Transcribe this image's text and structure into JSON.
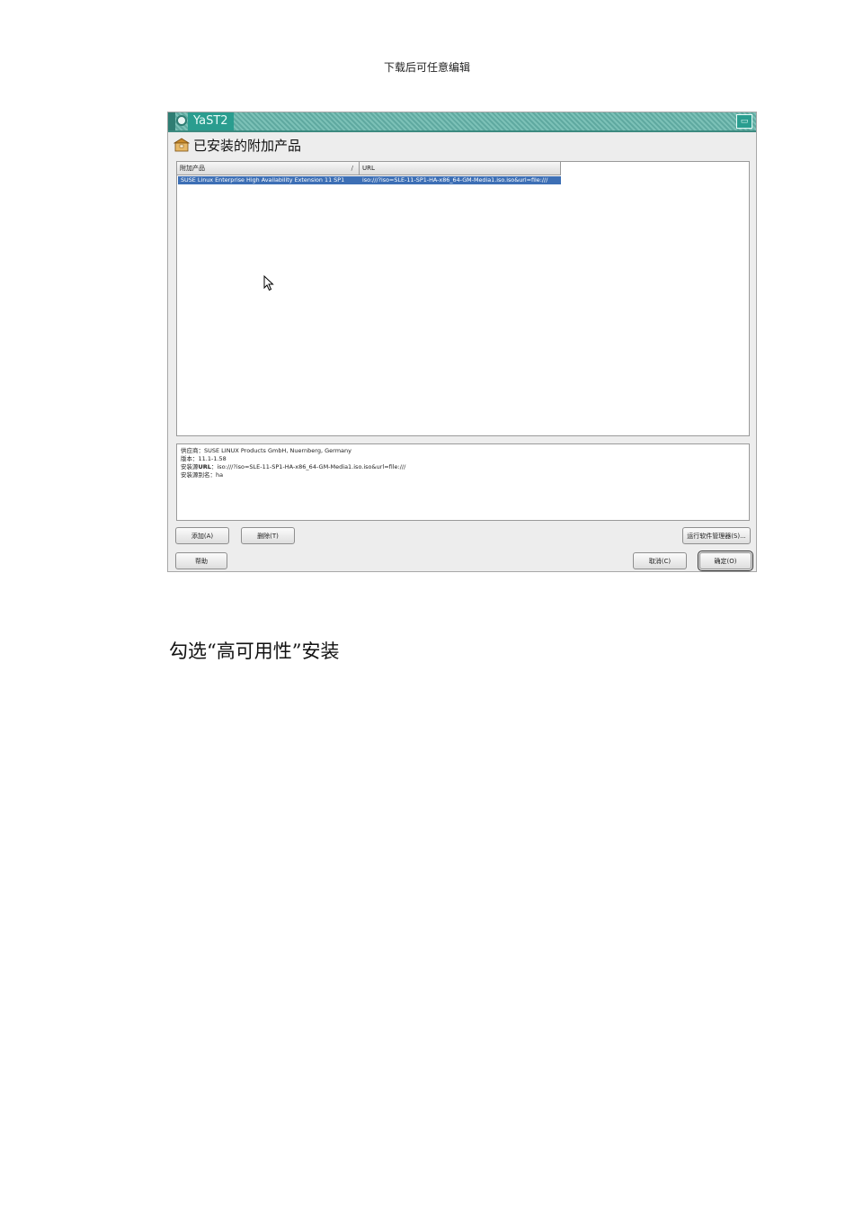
{
  "document": {
    "header": "下载后可任意编辑",
    "caption": "勾选“高可用性”安装"
  },
  "window": {
    "title": "YaST2",
    "dialog_title": "已安装的附加产品",
    "accent_color": "#2a9d8f"
  },
  "table": {
    "columns": [
      "附加产品",
      "URL"
    ],
    "sort_indicator": "/",
    "rows": [
      {
        "product": "SUSE Linux Enterprise High Availability Extension 11 SP1",
        "url": "iso:///?iso=SLE-11-SP1-HA-x86_64-GM-Media1.iso.iso&url=file:///",
        "selected": true
      }
    ]
  },
  "details": {
    "vendor_label": "供应商：",
    "vendor_value": "SUSE LINUX Products GmbH, Nuernberg, Germany",
    "version_label": "版本：",
    "version_value": "11.1-1.58",
    "source_label_prefix": "安装源",
    "source_label_bold": "URL",
    "source_label_sep": "：",
    "source_value": "iso:///?iso=SLE-11-SP1-HA-x86_64-GM-Media1.iso.iso&url=file:///",
    "alias_label": "安装源别名：",
    "alias_value": "ha"
  },
  "buttons": {
    "add": "添加(A)",
    "delete": "删除(T)",
    "run_manager": "运行软件管理器(S)...",
    "help": "帮助",
    "cancel": "取消(C)",
    "ok": "确定(O)"
  }
}
